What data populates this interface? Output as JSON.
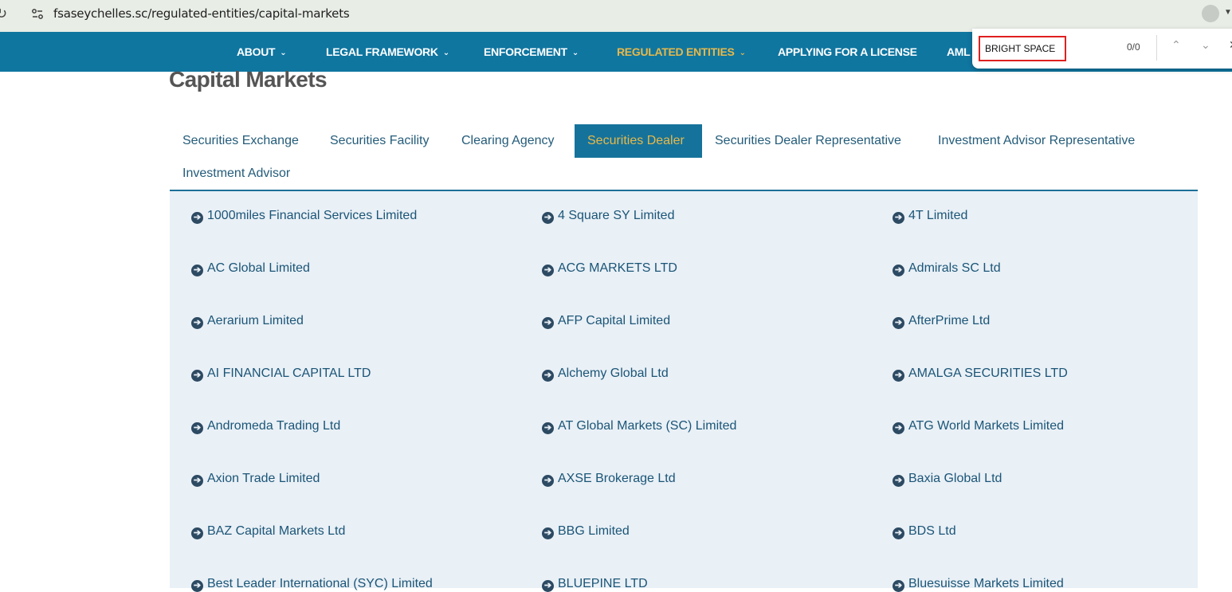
{
  "browser": {
    "url": "fsaseychelles.sc/regulated-entities/capital-markets"
  },
  "nav": {
    "items": [
      {
        "label": "ABOUT",
        "has_dropdown": true,
        "active": false
      },
      {
        "label": "LEGAL FRAMEWORK",
        "has_dropdown": true,
        "active": false
      },
      {
        "label": "ENFORCEMENT",
        "has_dropdown": true,
        "active": false
      },
      {
        "label": "REGULATED ENTITIES",
        "has_dropdown": true,
        "active": true
      },
      {
        "label": "APPLYING FOR A LICENSE",
        "has_dropdown": false,
        "active": false
      },
      {
        "label": "AML",
        "has_dropdown": false,
        "active": false
      }
    ]
  },
  "find_bar": {
    "query": "BRIGHT SPACE",
    "count": "0/0"
  },
  "page": {
    "title": "Capital Markets"
  },
  "tabs": [
    {
      "label": "Securities Exchange",
      "active": false
    },
    {
      "label": "Securities Facility",
      "active": false
    },
    {
      "label": "Clearing Agency",
      "active": false
    },
    {
      "label": "Securities Dealer",
      "active": true
    },
    {
      "label": "Securities Dealer Representative",
      "active": false
    },
    {
      "label": "Investment Advisor Representative",
      "active": false
    },
    {
      "label": "Investment Advisor",
      "active": false
    }
  ],
  "entities": [
    "1000miles Financial Services Limited",
    "4 Square SY Limited",
    "4T Limited",
    "AC Global Limited",
    "ACG MARKETS LTD",
    "Admirals SC Ltd",
    "Aerarium Limited",
    "AFP Capital Limited",
    "AfterPrime Ltd",
    "AI FINANCIAL CAPITAL LTD",
    "Alchemy Global Ltd",
    "AMALGA SECURITIES LTD",
    "Andromeda Trading Ltd",
    "AT Global Markets (SC) Limited",
    "ATG World Markets Limited",
    "Axion Trade Limited",
    "AXSE Brokerage Ltd",
    "Baxia Global Ltd",
    "BAZ Capital Markets Ltd",
    "BBG Limited",
    "BDS Ltd",
    "Best Leader International (SYC) Limited",
    "BLUEPINE LTD",
    "Bluesuisse Markets Limited"
  ],
  "colors": {
    "nav_bg": "#0f76a0",
    "active_accent": "#e7b84a",
    "content_bg": "#e9f0f6",
    "link": "#1b5577"
  }
}
